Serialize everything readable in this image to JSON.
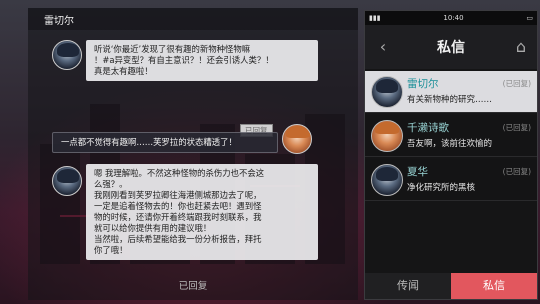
{
  "chat": {
    "contact_name": "雷切尔",
    "messages": [
      {
        "speaker": "雷切尔",
        "text_lines": [
          "听说‘你最近’发现了很有趣的新物种怪物嘛",
          "！#a异变型？有自主意识？！还会引诱人类？！",
          "真是太有趣啦！"
        ]
      },
      {
        "speaker": "me",
        "status": "已回复",
        "text": "一点都不觉得有趣啊……芙罗拉的状态糟透了！"
      },
      {
        "speaker": "雷切尔",
        "text_lines": [
          "嗯 我理解啦。不然这种怪物的杀伤力也不会这",
          "么强？。",
          "我刚刚看到芙罗拉卿往海港侧城那边去了呢，",
          "一定是追着怪物去的！你也赶紧去吧！遇到怪",
          "物的时候，还请你开着终端跟我时刻联系，我",
          "就可以给你提供有用的建议哦！",
          "当然啦，后续希望能给我一份分析报告，拜托",
          "你了哦！"
        ]
      }
    ],
    "bottom_status": "已回复"
  },
  "phone": {
    "time": "10:40",
    "title": "私信",
    "contacts": [
      {
        "name": "雷切尔",
        "tag": "(已回复)",
        "preview": "有关新物种的研究……"
      },
      {
        "name": "千濑诗歌",
        "tag": "(已回复)",
        "preview": "吾友啊，该前往欢愉的"
      },
      {
        "name": "夏华",
        "tag": "(已回复)",
        "preview": "净化研究所的黑核"
      }
    ],
    "tabs": {
      "rumor": "传闻",
      "private": "私信"
    }
  }
}
